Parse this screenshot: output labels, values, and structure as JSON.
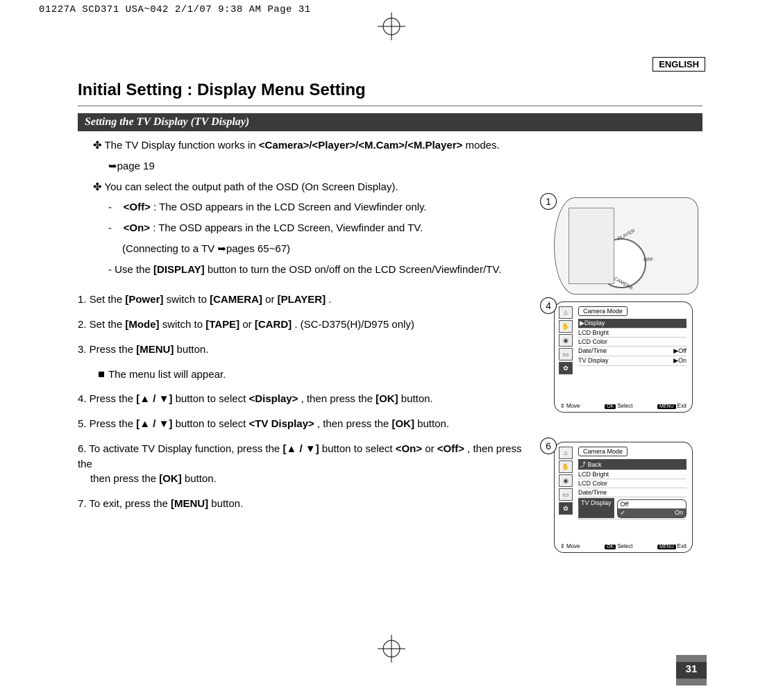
{
  "print_header": "01227A SCD371 USA~042  2/1/07 9:38 AM  Page 31",
  "lang_badge": "ENGLISH",
  "page_title": "Initial Setting : Display Menu Setting",
  "section_title": "Setting the TV Display (TV Display)",
  "intro": {
    "line1_prefix": "✤ The TV Display function works in ",
    "line1_bold": "<Camera>/<Player>/<M.Cam>/<M.Player>",
    "line1_suffix": " modes.",
    "page_ref": "➥page 19",
    "line2": "✤ You can select the output path of the OSD (On Screen Display).",
    "off_label": "<Off>",
    "off_text": ": The OSD appears in the LCD Screen and Viewfinder only.",
    "on_label": "<On>",
    "on_text": ": The OSD appears in the LCD Screen, Viewfinder and TV.",
    "on_extra": "(Connecting to a TV ➥pages 65~67)",
    "display_bold": "[DISPLAY]",
    "display_text_pre": "-   Use the ",
    "display_text_post": " button to turn the OSD on/off on the LCD Screen/Viewfinder/TV."
  },
  "steps": {
    "s1_pre": "1. Set the ",
    "s1_b1": "[Power]",
    "s1_mid": " switch to ",
    "s1_b2": "[CAMERA]",
    "s1_or": " or ",
    "s1_b3": "[PLAYER]",
    "s1_end": ".",
    "s2_pre": "2. Set the ",
    "s2_b1": "[Mode]",
    "s2_mid": " switch to ",
    "s2_b2": "[TAPE]",
    "s2_or": " or ",
    "s2_b3": "[CARD]",
    "s2_end": ". (SC-D375(H)/D975 only)",
    "s3_pre": "3. Press the ",
    "s3_b1": "[MENU]",
    "s3_end": " button.",
    "s3_bullet": "The menu list will appear.",
    "s4_pre": "4. Press the ",
    "s4_b1": "[▲ / ▼]",
    "s4_mid": " button to select ",
    "s4_b2": "<Display>",
    "s4_mid2": ", then press the ",
    "s4_b3": "[OK]",
    "s4_end": " button.",
    "s5_pre": "5. Press the ",
    "s5_b1": "[▲ / ▼]",
    "s5_mid": " button to select ",
    "s5_b2": "<TV Display>",
    "s5_mid2": ", then press the ",
    "s5_b3": "[OK]",
    "s5_end": " button.",
    "s6_pre": "6. To activate TV Display function, press the ",
    "s6_b1": "[▲ / ▼]",
    "s6_mid": " button to select ",
    "s6_b2": "<On>",
    "s6_or": " or ",
    "s6_b3": "<Off>",
    "s6_mid2": ", then press the ",
    "s6_b4": "[OK]",
    "s6_end": " button.",
    "s7_pre": "7. To exit, press the ",
    "s7_b1": "[MENU]",
    "s7_end": " button."
  },
  "figures": {
    "f1": {
      "num": "1",
      "knob": {
        "player": "PLAYER",
        "off": "OFF",
        "camera": "CAMERA"
      }
    },
    "f4": {
      "num": "4",
      "title": "Camera Mode",
      "items": [
        "▶Display",
        "LCD Bright",
        "LCD Color",
        "Date/Time",
        "TV Display"
      ],
      "right": [
        "",
        "",
        "",
        "▶Off",
        "▶On"
      ],
      "help": {
        "move": "Move",
        "ok": "OK",
        "select": "Select",
        "menu": "MENU",
        "exit": "Exit"
      }
    },
    "f6": {
      "num": "6",
      "title": "Camera Mode",
      "back": "⤴ Back",
      "items": [
        "LCD Bright",
        "LCD Color",
        "Date/Time",
        "TV Display"
      ],
      "options": [
        {
          "label": "Off",
          "selected": false
        },
        {
          "label": "On",
          "selected": true
        }
      ],
      "help": {
        "move": "Move",
        "ok": "OK",
        "select": "Select",
        "menu": "MENU",
        "exit": "Exit"
      }
    }
  },
  "page_number": "31"
}
